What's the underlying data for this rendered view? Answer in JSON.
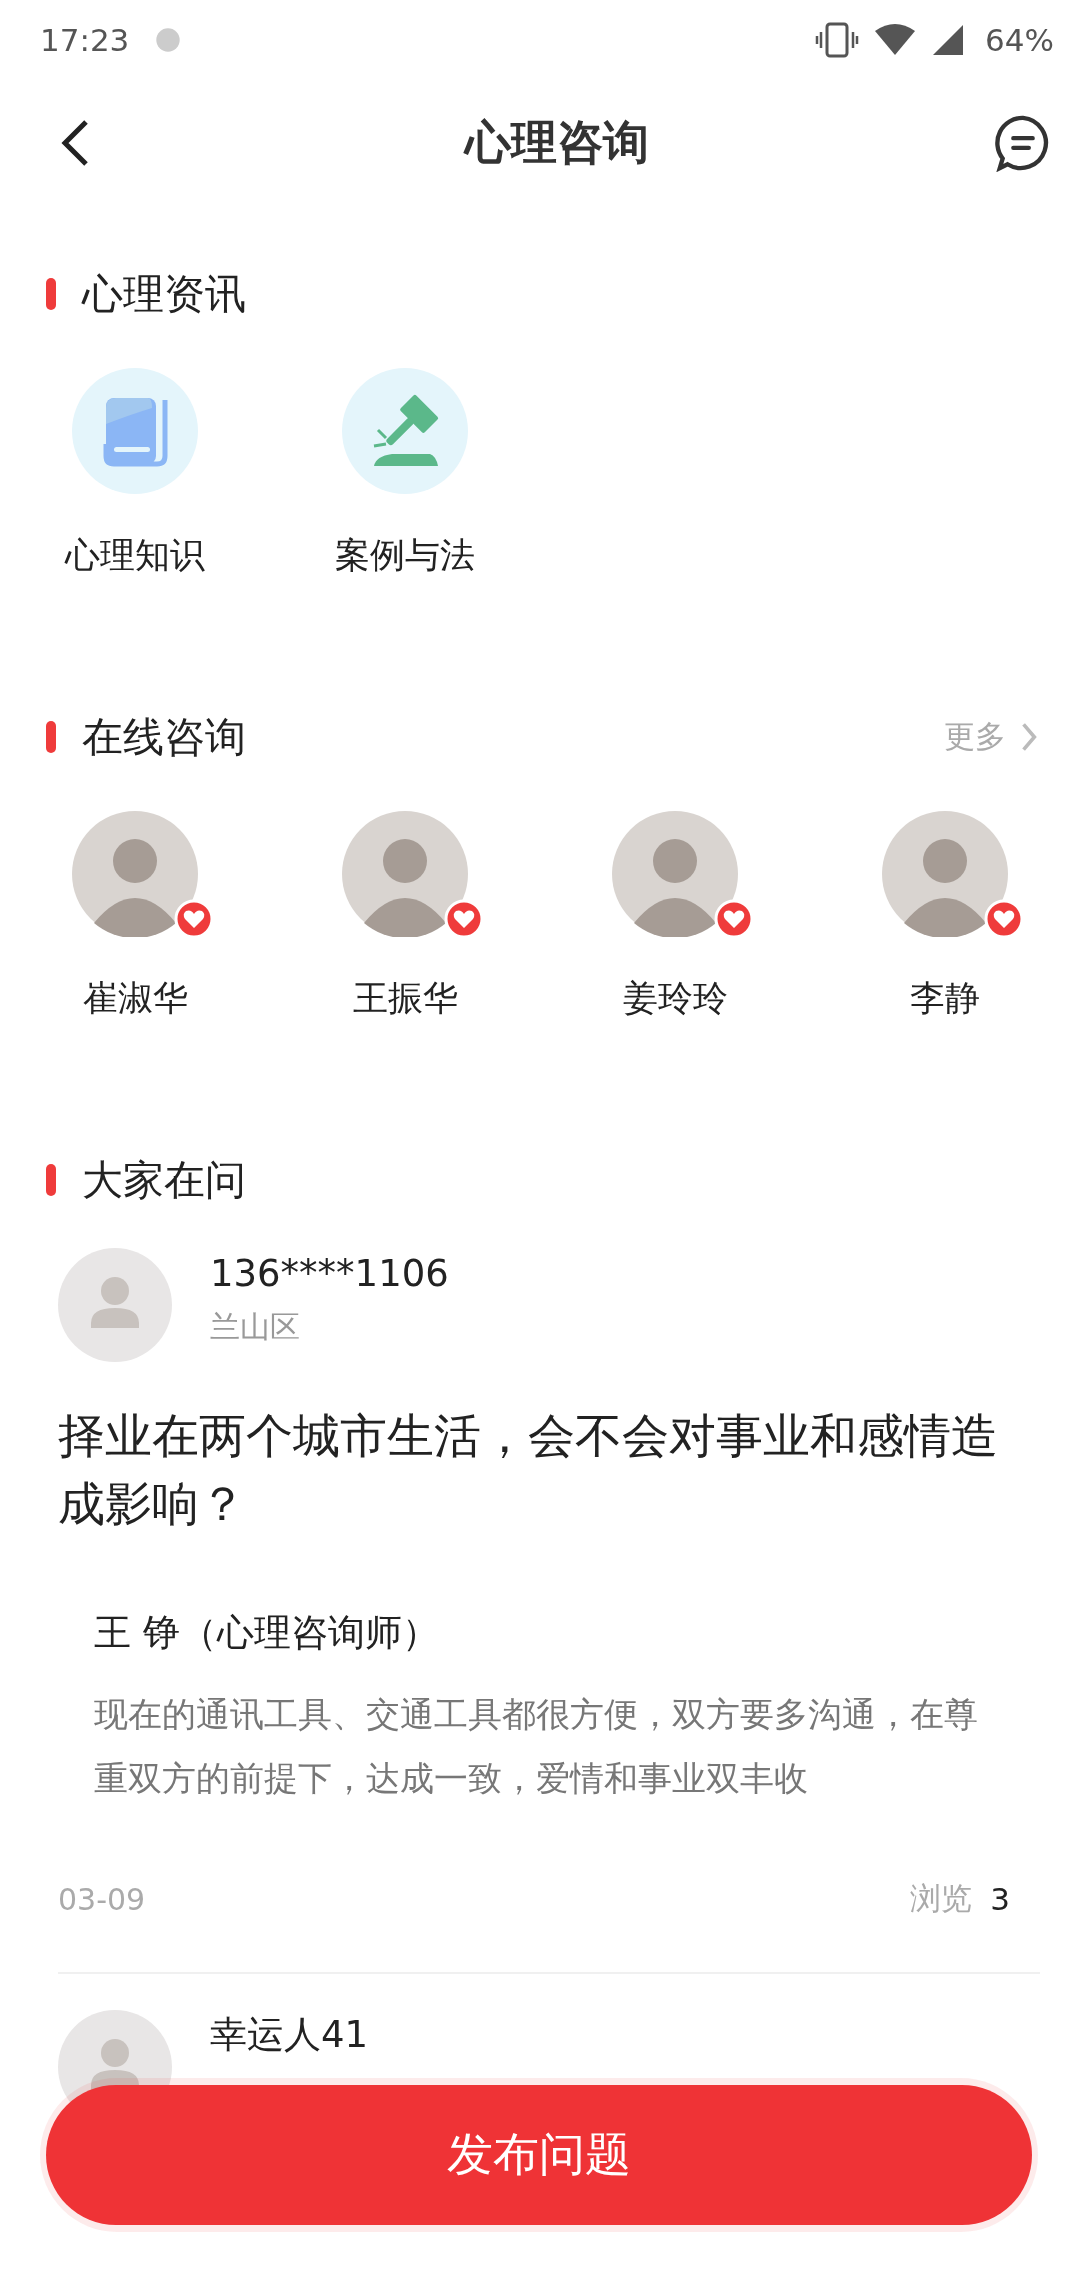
{
  "status_bar": {
    "time": "17:23",
    "battery": "64%"
  },
  "header": {
    "title": "心理咨询"
  },
  "sections": [
    {
      "title": "心理资讯"
    },
    {
      "title": "在线咨询",
      "more": "更多"
    },
    {
      "title": "大家在问"
    }
  ],
  "categories": [
    {
      "label": "心理知识",
      "kind": "book"
    },
    {
      "label": "案例与法",
      "kind": "gavel"
    }
  ],
  "counselors": [
    {
      "name": "崔淑华"
    },
    {
      "name": "王振华"
    },
    {
      "name": "姜玲玲"
    },
    {
      "name": "李静"
    }
  ],
  "questions": [
    {
      "user": "136****1106",
      "district": "兰山区",
      "text": "择业在两个城市生活，会不会对事业和感情造成影响？",
      "answer": {
        "author": "王  铮（心理咨询师）",
        "text": "现在的通讯工具、交通工具都很方便，双方要多沟通，在尊重双方的前提下，达成一致，爱情和事业双丰收"
      },
      "date": "03-09",
      "views_label": "浏览",
      "views": "3"
    },
    {
      "user": "幸运人41"
    }
  ],
  "publish_button": "发布问题"
}
